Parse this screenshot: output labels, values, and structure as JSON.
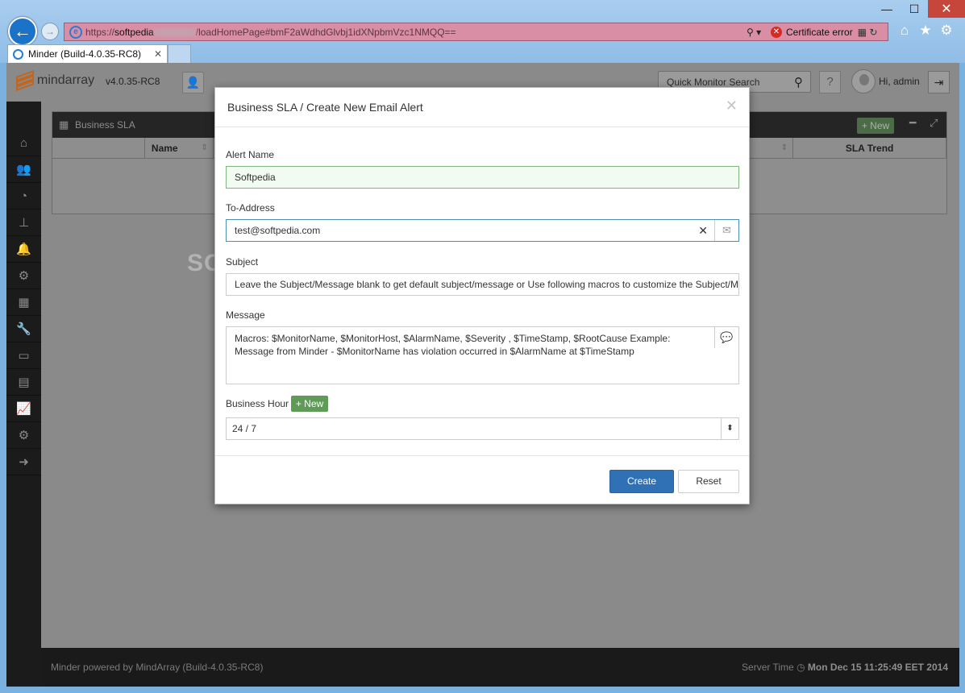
{
  "browser": {
    "url_prefix": "https://",
    "url_host": "softpedia",
    "url_path": "/loadHomePage#bmF2aWdhdGlvbj1idXNpbmVzc1NMQQ==",
    "cert_error": "Certificate error",
    "tab_title": "Minder (Build-4.0.35-RC8)",
    "tab_close": "✕"
  },
  "app": {
    "logo_text": "mindarray",
    "version": "v4.0.35-RC8",
    "search_label": "Quick Monitor Search",
    "help_label": "?",
    "greeting": "Hi, admin"
  },
  "panel": {
    "title": "Business SLA",
    "new_label": "+ New",
    "columns": [
      "Name",
      "SLA Trend"
    ]
  },
  "modal": {
    "title": "Business SLA / Create New Email Alert",
    "close": "✕",
    "alert_name_label": "Alert Name",
    "alert_name_value": "Softpedia",
    "to_label": "To-Address",
    "to_value": "test@softpedia.com",
    "subject_label": "Subject",
    "subject_value": "Leave the Subject/Message blank to get default subject/message or Use following macros to customize the Subject/Message",
    "message_label": "Message",
    "message_value": "Macros: $MonitorName, $MonitorHost, $AlarmName, $Severity , $TimeStamp, $RootCause Example: Message from Minder - $MonitorName has violation occurred in $AlarmName at $TimeStamp",
    "business_hour_label": "Business Hour",
    "business_hour_new": "+ New",
    "business_hour_value": "24 / 7",
    "create_label": "Create",
    "reset_label": "Reset"
  },
  "footer": {
    "left": "Minder powered by MindArray (Build-4.0.35-RC8)",
    "server_time_label": "Server Time",
    "server_time_value": "Mon Dec 15 11:25:49 EET 2014"
  },
  "watermark": "SOFTPEDIA",
  "icons": {
    "back": "arrow-left-icon",
    "forward": "arrow-right-icon",
    "home": "home-icon",
    "favorites": "star-icon",
    "settings": "gear-icon"
  }
}
